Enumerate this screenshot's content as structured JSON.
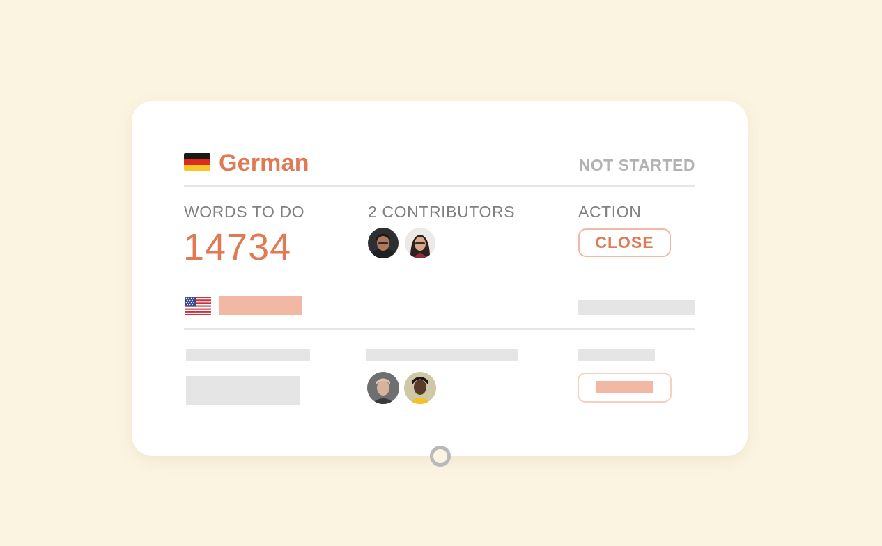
{
  "card": {
    "language": "German",
    "status": "NOT STARTED",
    "words_label": "WORDS TO DO",
    "words_value": "14734",
    "contributors_label": "2 CONTRIBUTORS",
    "action_label": "ACTION",
    "action_button": "CLOSE"
  },
  "icons": {
    "primary_flag": "german-flag-icon",
    "secondary_flag": "us-flag-icon"
  },
  "colors": {
    "background": "#fbf4e1",
    "accent": "#e07a55",
    "accent_light": "#f3b8a4",
    "muted_text": "#808080",
    "status_text": "#b2b2b2",
    "placeholder": "#e5e5e5"
  }
}
